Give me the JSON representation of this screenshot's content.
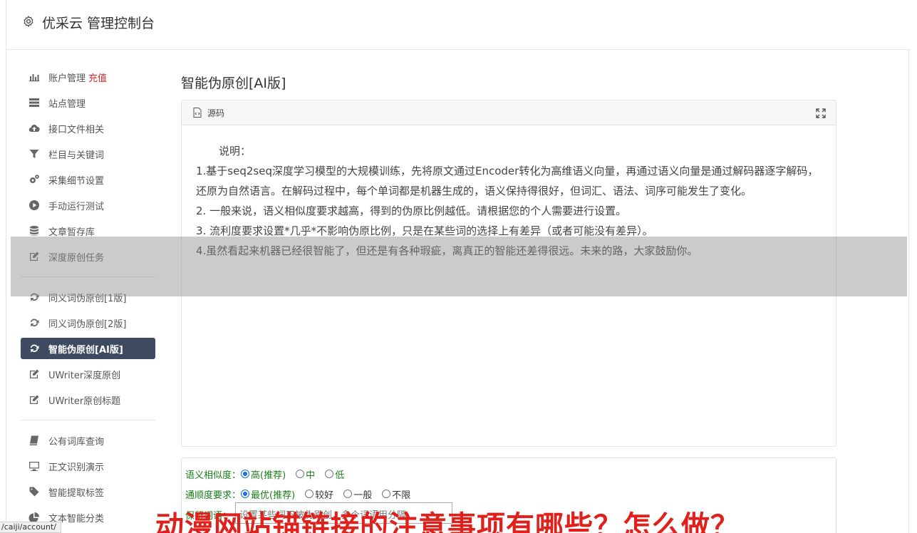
{
  "header": {
    "title": "优采云 管理控制台"
  },
  "sidebar": {
    "account": {
      "label": "账户管理",
      "badge": "充值"
    },
    "group1": [
      {
        "label": "站点管理",
        "icon": "server-icon"
      },
      {
        "label": "接口文件相关",
        "icon": "cloud-upload-icon"
      },
      {
        "label": "栏目与关键词",
        "icon": "filter-icon"
      },
      {
        "label": "采集细节设置",
        "icon": "cogs-icon"
      },
      {
        "label": "手动运行测试",
        "icon": "play-icon"
      },
      {
        "label": "文章暂存库",
        "icon": "database-icon"
      },
      {
        "label": "深度原创任务",
        "icon": "edit-icon"
      }
    ],
    "group2": [
      {
        "label": "同义词伪原创[1版]",
        "icon": "refresh-icon"
      },
      {
        "label": "同义词伪原创[2版]",
        "icon": "refresh-icon"
      },
      {
        "label": "智能伪原创[AI版]",
        "icon": "refresh-icon",
        "active": true
      },
      {
        "label": "UWriter深度原创",
        "icon": "edit-icon"
      },
      {
        "label": "UWriter原创标题",
        "icon": "edit-icon"
      }
    ],
    "group3": [
      {
        "label": "公有词库查询",
        "icon": "book-icon"
      },
      {
        "label": "正文识别演示",
        "icon": "monitor-icon"
      },
      {
        "label": "智能提取标签",
        "icon": "tag-icon"
      },
      {
        "label": "文本智能分类",
        "icon": "pie-chart-icon"
      }
    ]
  },
  "main": {
    "title": "智能伪原创[AI版]",
    "panel": {
      "tab_label": "源码",
      "heading": "说明：",
      "lines": [
        "1.基于seq2seq深度学习模型的大规模训练，先将原文通过Encoder转化为高维语义向量，再通过语义向量是通过解码器逐字解码，还原为自然语言。在解码过程中，每个单词都是机器生成的，语义保持得很好，但词汇、语法、词序可能发生了变化。",
        "2. 一般来说，语义相似度要求越高，得到的伪原比例越低。请根据您的个人需要进行设置。",
        "3. 流利度要求设置*几乎*不影响伪原比例，只是在某些词的选择上有差异（或者可能没有差异）。",
        "4.虽然看起来机器已经很智能了，但还是有各种瑕疵，离真正的智能还差得很远。未来的路，大家鼓励你。"
      ]
    },
    "options": {
      "similarity": {
        "label": "语义相似度：",
        "choices": [
          "高(推荐)",
          "中",
          "低"
        ],
        "selected": 0
      },
      "fluency": {
        "label": "通顺度要求：",
        "choices": [
          "最优(推荐)",
          "较好",
          "一般",
          "不限"
        ],
        "selected": 0
      },
      "protect": {
        "label": "保留词语：",
        "placeholder": "设置某些词不被伪原创，多个词语用分隔"
      }
    }
  },
  "status_url": "/caiji/account/",
  "watermark": "动漫网站锚链接的注意事项有哪些？怎么做？"
}
